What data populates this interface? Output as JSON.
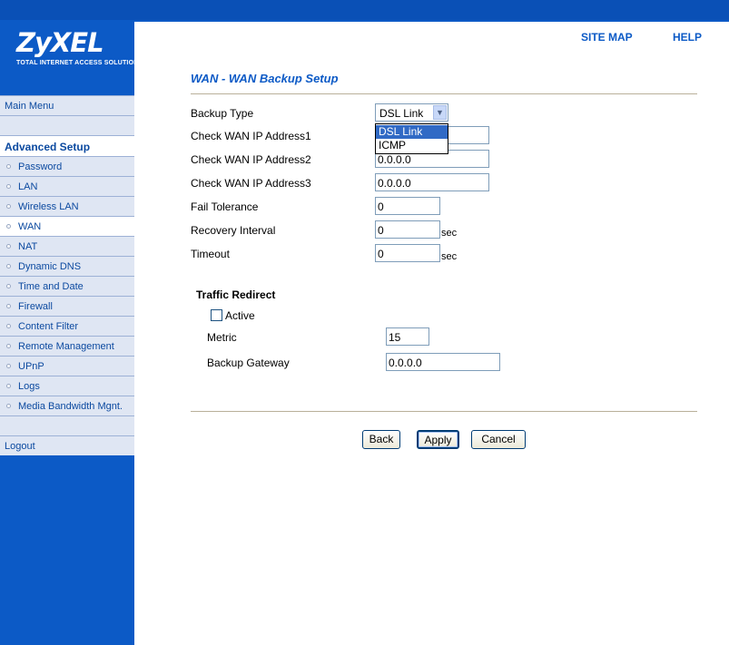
{
  "header": {
    "logo": "ZyXEL",
    "logo_sub": "TOTAL INTERNET ACCESS SOLUTION",
    "links": [
      "SITE MAP",
      "HELP"
    ]
  },
  "sidebar": {
    "main_menu": "Main Menu",
    "section_title": "Advanced Setup",
    "items": [
      "Password",
      "LAN",
      "Wireless LAN",
      "WAN",
      "NAT",
      "Dynamic DNS",
      "Time and Date",
      "Firewall",
      "Content Filter",
      "Remote Management",
      "UPnP",
      "Logs",
      "Media Bandwidth Mgnt."
    ],
    "selected": "WAN",
    "logout": "Logout"
  },
  "page": {
    "title": "WAN - WAN Backup Setup"
  },
  "form": {
    "backup_type_label": "Backup Type",
    "backup_type_value": "DSL Link",
    "backup_type_options": [
      "DSL Link",
      "ICMP"
    ],
    "check_ip1_label": "Check WAN IP Address1",
    "check_ip1_value": "",
    "check_ip2_label": "Check WAN IP Address2",
    "check_ip2_value": "0.0.0.0",
    "check_ip3_label": "Check WAN IP Address3",
    "check_ip3_value": "0.0.0.0",
    "fail_tolerance_label": "Fail Tolerance",
    "fail_tolerance_value": "0",
    "recovery_interval_label": "Recovery Interval",
    "recovery_interval_value": "0",
    "timeout_label": "Timeout",
    "timeout_value": "0",
    "unit_sec": "sec"
  },
  "traffic_redirect": {
    "title": "Traffic Redirect",
    "active_label": "Active",
    "active_checked": false,
    "metric_label": "Metric",
    "metric_value": "15",
    "gateway_label": "Backup Gateway",
    "gateway_value": "0.0.0.0"
  },
  "buttons": {
    "back": "Back",
    "apply": "Apply",
    "cancel": "Cancel"
  },
  "colors": {
    "brand_blue": "#0c5ac6",
    "title_blue": "#0c5ac6",
    "dropdown_highlight": "#316ac5"
  }
}
